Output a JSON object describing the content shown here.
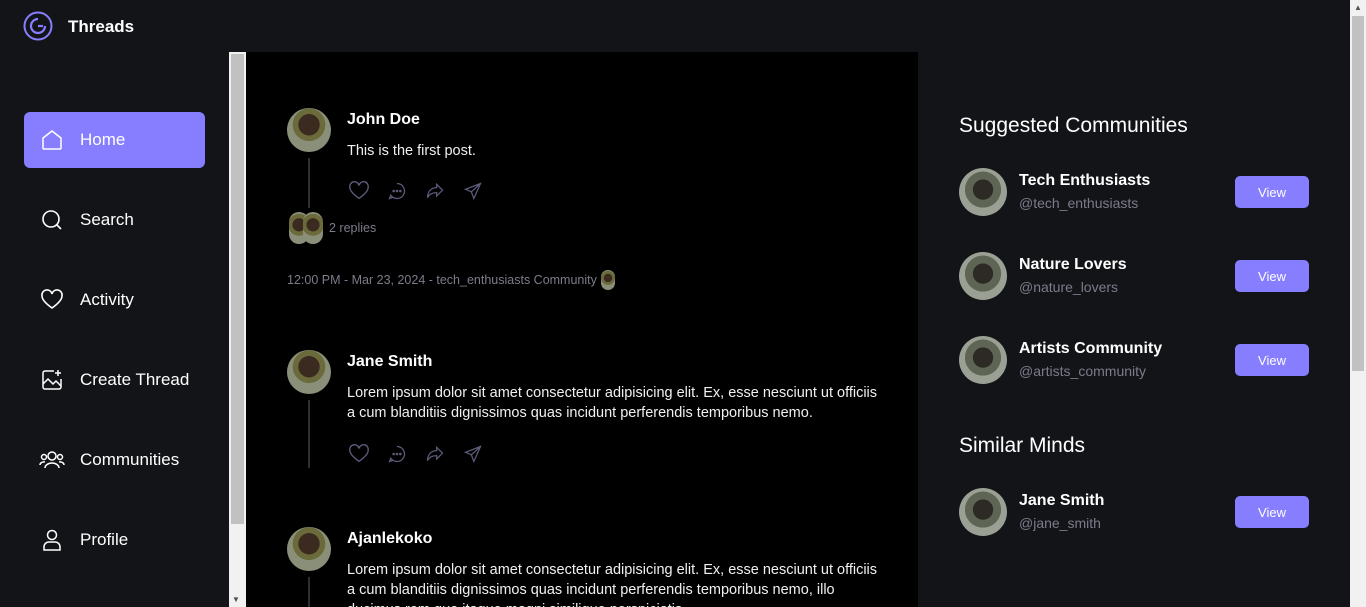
{
  "app": {
    "brand": "Threads"
  },
  "nav": [
    {
      "label": "Home",
      "icon": "home-icon",
      "active": true
    },
    {
      "label": "Search",
      "icon": "search-icon"
    },
    {
      "label": "Activity",
      "icon": "heart-icon"
    },
    {
      "label": "Create Thread",
      "icon": "image-plus-icon"
    },
    {
      "label": "Communities",
      "icon": "users-icon"
    },
    {
      "label": "Profile",
      "icon": "user-icon"
    }
  ],
  "posts": [
    {
      "author": "John Doe",
      "content": "This is the first post.",
      "replies": "2 replies",
      "meta": "12:00 PM - Mar 23, 2024 - tech_enthusiasts Community"
    },
    {
      "author": "Jane Smith",
      "content": "Lorem ipsum dolor sit amet consectetur adipisicing elit. Ex, esse nesciunt ut officiis a cum blanditiis dignissimos quas incidunt perferendis temporibus nemo."
    },
    {
      "author": "Ajanlekoko",
      "content": "Lorem ipsum dolor sit amet consectetur adipisicing elit. Ex, esse nesciunt ut officiis a cum blanditiis dignissimos quas incidunt perferendis temporibus nemo, illo ducimus rem quo itaque magni similique perspiciatis."
    }
  ],
  "suggested": {
    "title": "Suggested Communities",
    "items": [
      {
        "name": "Tech Enthusiasts",
        "handle": "@tech_enthusiasts",
        "button": "View"
      },
      {
        "name": "Nature Lovers",
        "handle": "@nature_lovers",
        "button": "View"
      },
      {
        "name": "Artists Community",
        "handle": "@artists_community",
        "button": "View"
      }
    ]
  },
  "similar": {
    "title": "Similar Minds",
    "items": [
      {
        "name": "Jane Smith",
        "handle": "@jane_smith",
        "button": "View"
      }
    ]
  },
  "colors": {
    "accent": "#877eff",
    "bg": "#121417",
    "feed": "#000000",
    "muted": "#7c7c8a"
  }
}
